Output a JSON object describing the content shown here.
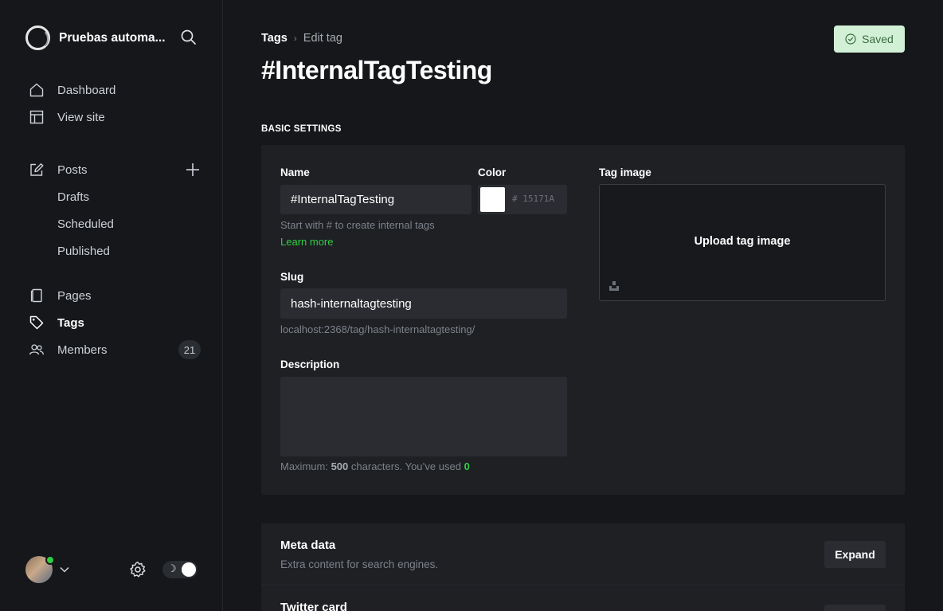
{
  "sidebar": {
    "site_name": "Pruebas automa...",
    "nav_main": [
      {
        "label": "Dashboard",
        "icon": "home-icon"
      },
      {
        "label": "View site",
        "icon": "layout-icon"
      }
    ],
    "posts": {
      "label": "Posts",
      "icon": "pencil-icon"
    },
    "posts_sub": [
      "Drafts",
      "Scheduled",
      "Published"
    ],
    "nav_secondary": [
      {
        "label": "Pages",
        "icon": "page-icon"
      },
      {
        "label": "Tags",
        "icon": "tag-icon",
        "active": true
      },
      {
        "label": "Members",
        "icon": "members-icon",
        "count": "21"
      }
    ]
  },
  "header": {
    "breadcrumb_parent": "Tags",
    "breadcrumb_current": "Edit tag",
    "title": "#InternalTagTesting",
    "saved_label": "Saved"
  },
  "basic_settings": {
    "section_label": "BASIC SETTINGS",
    "name_label": "Name",
    "name_value": "#InternalTagTesting",
    "name_hint": "Start with # to create internal tags",
    "learn_more": "Learn more",
    "color_label": "Color",
    "color_hex": "# 15171A",
    "slug_label": "Slug",
    "slug_value": "hash-internaltagtesting",
    "slug_url": "localhost:2368/tag/hash-internaltagtesting/",
    "description_label": "Description",
    "description_value": "",
    "count_prefix": "Maximum:",
    "count_max": "500",
    "count_middle": "characters. You’ve used",
    "count_used": "0",
    "tag_image_label": "Tag image",
    "upload_label": "Upload tag image"
  },
  "meta_data": {
    "title": "Meta data",
    "subtitle": "Extra content for search engines.",
    "expand_label": "Expand"
  },
  "twitter_card": {
    "title": "Twitter card"
  },
  "colors": {
    "accent_green": "#30cf43",
    "background": "#15171a",
    "card": "#1e2024",
    "saved_bg": "#d2f0d6"
  }
}
